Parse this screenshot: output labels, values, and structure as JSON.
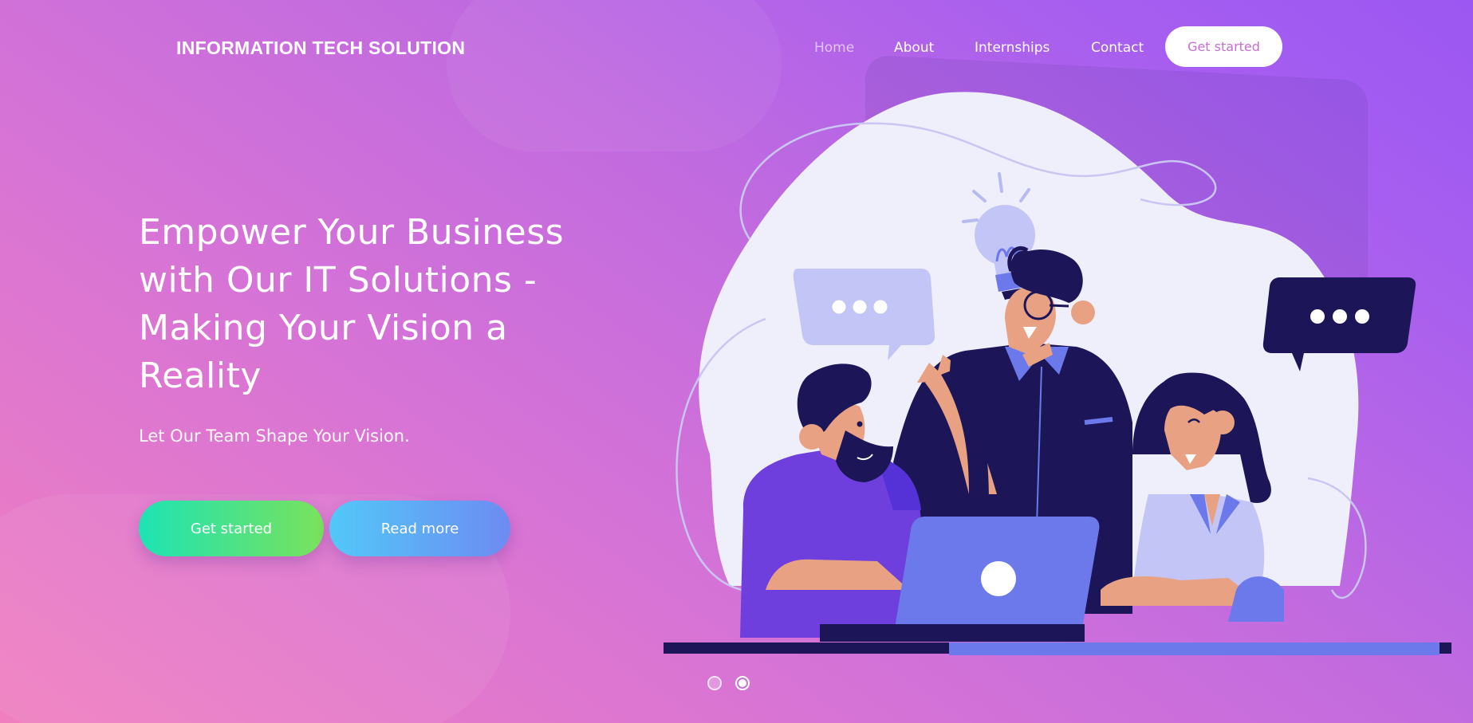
{
  "header": {
    "brand": "INFORMATION TECH SOLUTION",
    "nav": [
      {
        "label": "Home",
        "active": true
      },
      {
        "label": "About",
        "active": false
      },
      {
        "label": "Internships",
        "active": false
      },
      {
        "label": "Contact",
        "active": false
      }
    ],
    "cta_label": "Get started"
  },
  "hero": {
    "title": "Empower Your Business with Our IT Solutions - Making Your Vision a Reality",
    "subtitle": "Let Our Team Shape Your Vision.",
    "primary_button": "Get started",
    "secondary_button": "Read more"
  },
  "carousel": {
    "slide_count": 2,
    "active_slide": 2
  },
  "colors": {
    "background_start": "#f07fc0",
    "background_end": "#9c57f2",
    "primary_button_gradient": [
      "#1de3b4",
      "#7ae25c"
    ],
    "secondary_button_gradient": [
      "#52c8f8",
      "#6d8bf2"
    ],
    "cta_text": "#c46fd0",
    "illustration_navy": "#1c1658",
    "illustration_blue": "#6b79ea",
    "illustration_purple": "#6e3fdc",
    "illustration_skin": "#e8a283"
  },
  "illustration": {
    "icons": [
      "lightbulb-icon",
      "speech-bubble-icon",
      "speech-bubble-icon",
      "laptop-icon"
    ]
  }
}
